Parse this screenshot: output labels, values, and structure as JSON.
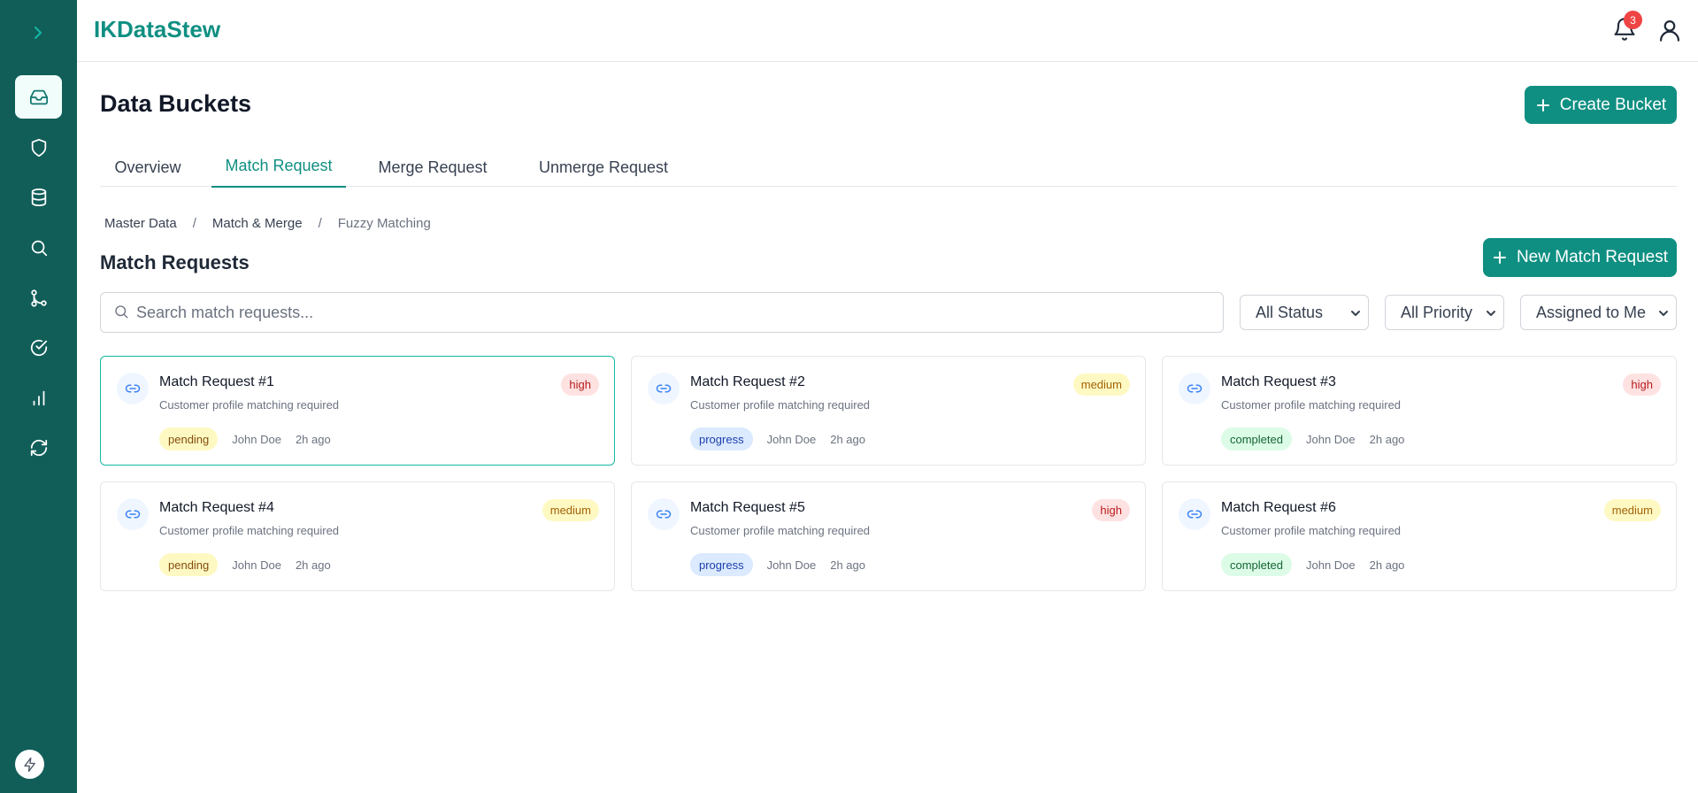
{
  "app": {
    "brand": "IKDataStew"
  },
  "header": {
    "notification_count": "3"
  },
  "sidebar": {
    "items": [
      {
        "icon": "inbox-icon",
        "active": true
      },
      {
        "icon": "shield-icon",
        "active": false
      },
      {
        "icon": "database-icon",
        "active": false
      },
      {
        "icon": "search-icon",
        "active": false
      },
      {
        "icon": "git-branch-icon",
        "active": false
      },
      {
        "icon": "check-circle-icon",
        "active": false
      },
      {
        "icon": "bar-chart-icon",
        "active": false
      },
      {
        "icon": "refresh-icon",
        "active": false
      }
    ]
  },
  "page": {
    "title": "Data Buckets",
    "create_button": "Create Bucket"
  },
  "tabs": [
    {
      "label": "Overview",
      "active": false
    },
    {
      "label": "Match Request",
      "active": true
    },
    {
      "label": "Merge Request",
      "active": false
    },
    {
      "label": "Unmerge Request",
      "active": false
    }
  ],
  "breadcrumb": [
    "Master Data",
    "Match & Merge",
    "Fuzzy Matching"
  ],
  "section": {
    "title": "Match Requests",
    "new_button": "New Match Request"
  },
  "filters": {
    "search_placeholder": "Search match requests...",
    "status": "All Status",
    "priority": "All Priority",
    "assignee": "Assigned to Me"
  },
  "cards": [
    {
      "title": "Match Request #1",
      "description": "Customer profile matching required",
      "priority": "high",
      "status": "pending",
      "assignee": "John Doe",
      "time": "2h ago"
    },
    {
      "title": "Match Request #2",
      "description": "Customer profile matching required",
      "priority": "medium",
      "status": "progress",
      "assignee": "John Doe",
      "time": "2h ago"
    },
    {
      "title": "Match Request #3",
      "description": "Customer profile matching required",
      "priority": "high",
      "status": "completed",
      "assignee": "John Doe",
      "time": "2h ago"
    },
    {
      "title": "Match Request #4",
      "description": "Customer profile matching required",
      "priority": "medium",
      "status": "pending",
      "assignee": "John Doe",
      "time": "2h ago"
    },
    {
      "title": "Match Request #5",
      "description": "Customer profile matching required",
      "priority": "high",
      "status": "progress",
      "assignee": "John Doe",
      "time": "2h ago"
    },
    {
      "title": "Match Request #6",
      "description": "Customer profile matching required",
      "priority": "medium",
      "status": "completed",
      "assignee": "John Doe",
      "time": "2h ago"
    }
  ],
  "colors": {
    "sidebar": "#115e59",
    "accent": "#0f8f82",
    "selected_border": "#14b8a6"
  }
}
